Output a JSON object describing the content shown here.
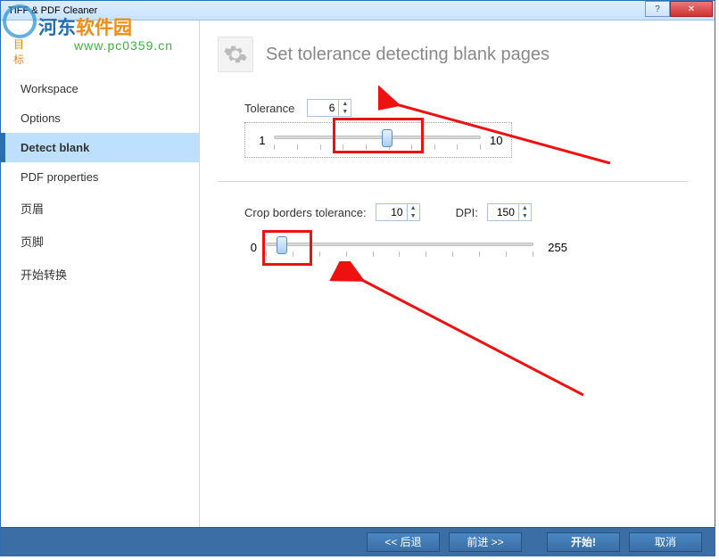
{
  "window": {
    "title": "TIFF & PDF Cleaner"
  },
  "watermark": {
    "line1a": "河东",
    "line1b": "软件园",
    "url": "www.pc0359.cn",
    "tag": "目 标"
  },
  "sidebar": {
    "items": [
      {
        "label": "Workspace"
      },
      {
        "label": "Options"
      },
      {
        "label": "Detect blank"
      },
      {
        "label": "PDF properties"
      },
      {
        "label": "页眉"
      },
      {
        "label": "页脚"
      },
      {
        "label": "开始转换"
      }
    ],
    "active_index": 2
  },
  "main": {
    "title": "Set tolerance detecting blank pages",
    "tolerance": {
      "label": "Tolerance",
      "value": "6",
      "slider_min": "1",
      "slider_max": "10",
      "slider_pos_percent": 52
    },
    "crop": {
      "label": "Crop borders tolerance:",
      "value": "10",
      "dpi_label": "DPI:",
      "dpi_value": "150",
      "slider_min": "0",
      "slider_max": "255",
      "slider_pos_percent": 4
    }
  },
  "footer": {
    "back": "<< 后退",
    "next": "前进 >>",
    "start": "开始!",
    "cancel": "取消"
  }
}
